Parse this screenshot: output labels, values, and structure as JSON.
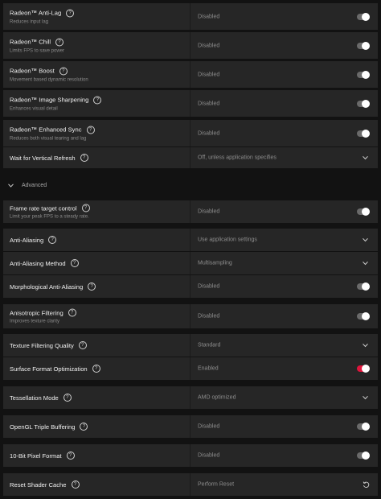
{
  "settings": [
    {
      "label": "Radeon™ Anti-Lag",
      "sub": "Reduces input lag",
      "value": "Disabled",
      "control": "toggle",
      "on": false
    },
    {
      "label": "Radeon™ Chill",
      "sub": "Limits FPS to save power",
      "value": "Disabled",
      "control": "toggle",
      "on": false
    },
    {
      "label": "Radeon™ Boost",
      "sub": "Movement based dynamic resolution",
      "value": "Disabled",
      "control": "toggle",
      "on": false
    },
    {
      "label": "Radeon™ Image Sharpening",
      "sub": "Enhances visual detail",
      "value": "Disabled",
      "control": "toggle",
      "on": false
    },
    {
      "label": "Radeon™ Enhanced Sync",
      "sub": "Reduces both visual tearing and lag",
      "value": "Disabled",
      "control": "toggle",
      "on": false
    },
    {
      "label": "Wait for Vertical Refresh",
      "sub": "",
      "value": "Off, unless application specifies",
      "control": "dropdown"
    }
  ],
  "advanced": {
    "label": "Advanced"
  },
  "advanced_settings": [
    {
      "label": "Frame rate target control",
      "sub": "Limit your peak FPS to a steady rate.",
      "value": "Disabled",
      "control": "toggle",
      "on": false
    },
    {
      "label": "Anti-Aliasing",
      "sub": "",
      "value": "Use application settings",
      "control": "dropdown"
    },
    {
      "label": "Anti-Aliasing Method",
      "sub": "",
      "value": "Multisampling",
      "control": "dropdown"
    },
    {
      "label": "Morphological Anti-Aliasing",
      "sub": "",
      "value": "Disabled",
      "control": "toggle",
      "on": false
    },
    {
      "label": "Anisotropic Filtering",
      "sub": "Improves texture clarity",
      "value": "Disabled",
      "control": "toggle",
      "on": false
    },
    {
      "label": "Texture Filtering Quality",
      "sub": "",
      "value": "Standard",
      "control": "dropdown"
    },
    {
      "label": "Surface Format Optimization",
      "sub": "",
      "value": "Enabled",
      "control": "toggle",
      "on": true
    },
    {
      "label": "Tessellation Mode",
      "sub": "",
      "value": "AMD optimized",
      "control": "dropdown"
    },
    {
      "label": "OpenGL Triple Buffering",
      "sub": "",
      "value": "Disabled",
      "control": "toggle",
      "on": false
    },
    {
      "label": "10-Bit Pixel Format",
      "sub": "",
      "value": "Disabled",
      "control": "toggle",
      "on": false
    },
    {
      "label": "Reset Shader Cache",
      "sub": "",
      "value": "Perform Reset",
      "control": "reset"
    }
  ],
  "icons": {
    "help": "help-circle-icon",
    "dropdown": "chevron-down-icon",
    "reset": "reset-icon",
    "advanced": "chevron-down-icon"
  },
  "colors": {
    "toggle_on": "#e0153c",
    "toggle_off": "#6a6a6a",
    "row_bg": "#262626"
  }
}
